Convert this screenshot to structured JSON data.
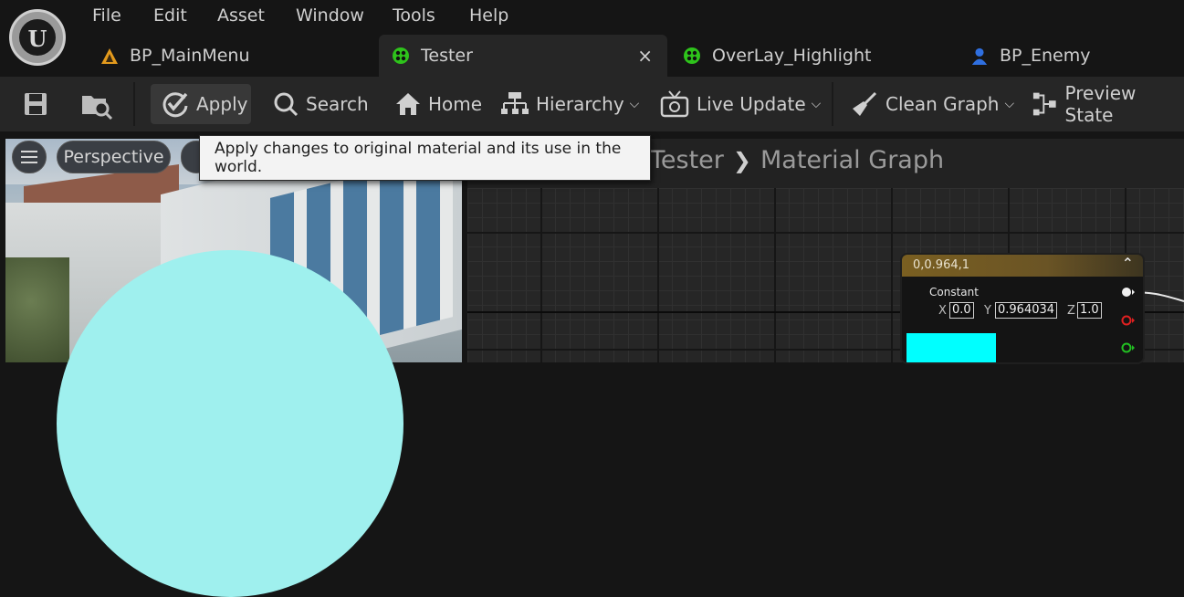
{
  "menu": [
    "File",
    "Edit",
    "Asset",
    "Window",
    "Tools",
    "Help"
  ],
  "tabs": [
    {
      "label": "BP_MainMenu",
      "icon": "warning-triangle-icon"
    },
    {
      "label": "Tester",
      "icon": "material-sphere-icon",
      "active": true
    },
    {
      "label": "OverLay_Highlight",
      "icon": "material-sphere-icon"
    },
    {
      "label": "BP_Enemy",
      "icon": "character-icon"
    }
  ],
  "tab_close_symbol": "×",
  "toolbar": {
    "apply": "Apply",
    "search": "Search",
    "home": "Home",
    "hierarchy": "Hierarchy",
    "live_update": "Live Update",
    "clean_graph": "Clean Graph",
    "preview_state": "Preview State"
  },
  "viewport": {
    "perspective": "Perspective"
  },
  "tooltip": "Apply changes to original material and its use in the world.",
  "breadcrumb": {
    "root": "Tester",
    "child": "Material Graph"
  },
  "node": {
    "title": "0,0.964,1",
    "type": "Constant",
    "x_label": "X",
    "x_value": "0.0",
    "y_label": "Y",
    "y_value": "0.964034",
    "z_label": "Z",
    "z_value": "1.0",
    "swatch_color": "#00ffff"
  },
  "colors": {
    "tab_active": "#262626",
    "node_header": "#7a5f21",
    "accent_green": "#2ec31b"
  }
}
